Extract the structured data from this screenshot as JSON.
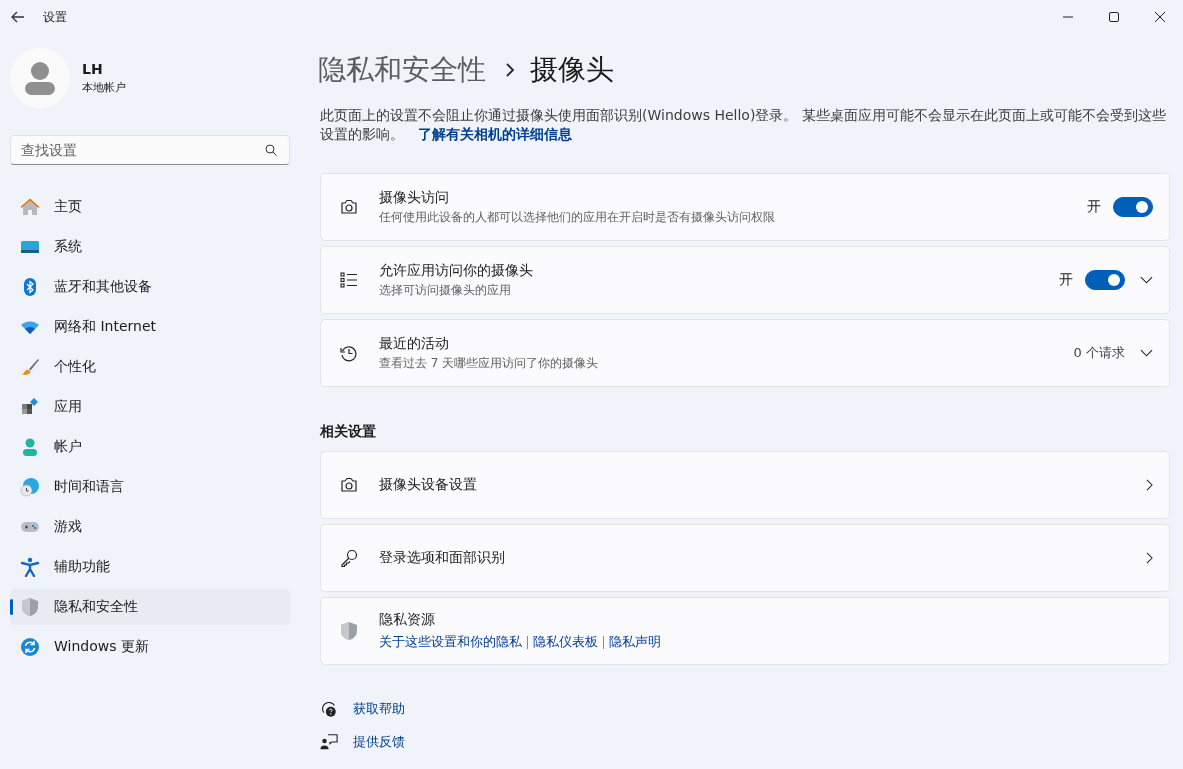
{
  "window": {
    "title": "设置"
  },
  "user": {
    "name": "LH",
    "account_type": "本地帐户"
  },
  "search": {
    "placeholder": "查找设置"
  },
  "sidebar": {
    "items": [
      {
        "label": "主页",
        "selected": false
      },
      {
        "label": "系统",
        "selected": false
      },
      {
        "label": "蓝牙和其他设备",
        "selected": false
      },
      {
        "label": "网络和 Internet",
        "selected": false
      },
      {
        "label": "个性化",
        "selected": false
      },
      {
        "label": "应用",
        "selected": false
      },
      {
        "label": "帐户",
        "selected": false
      },
      {
        "label": "时间和语言",
        "selected": false
      },
      {
        "label": "游戏",
        "selected": false
      },
      {
        "label": "辅助功能",
        "selected": false
      },
      {
        "label": "隐私和安全性",
        "selected": true
      },
      {
        "label": "Windows 更新",
        "selected": false
      }
    ]
  },
  "breadcrumb": [
    "隐私和安全性",
    "摄像头"
  ],
  "description": {
    "text": "此页面上的设置不会阻止你通过摄像头使用面部识别(Windows Hello)登录。 某些桌面应用可能不会显示在此页面上或可能不会受到这些设置的影响。",
    "link": "了解有关相机的详细信息"
  },
  "cards": [
    {
      "kind": "toggle",
      "title": "摄像头访问",
      "subtitle": "任何使用此设备的人都可以选择他们的应用在开启时是否有摄像头访问权限",
      "state_label": "开",
      "on": true
    },
    {
      "kind": "toggle",
      "title": "允许应用访问你的摄像头",
      "subtitle": "选择可访问摄像头的应用",
      "state_label": "开",
      "on": true,
      "expanded": false
    },
    {
      "kind": "value",
      "title": "最近的活动",
      "subtitle": "查看过去 7 天哪些应用访问了你的摄像头",
      "value": "0 个请求",
      "expanded": false
    }
  ],
  "related": {
    "heading": "相关设置",
    "items": [
      {
        "kind": "link",
        "title": "摄像头设备设置"
      },
      {
        "kind": "link",
        "title": "登录选项和面部识别"
      },
      {
        "kind": "resources",
        "title": "隐私资源",
        "links": [
          "关于这些设置和你的隐私",
          "隐私仪表板",
          "隐私声明"
        ]
      }
    ]
  },
  "footer_links": [
    "获取帮助",
    "提供反馈"
  ]
}
